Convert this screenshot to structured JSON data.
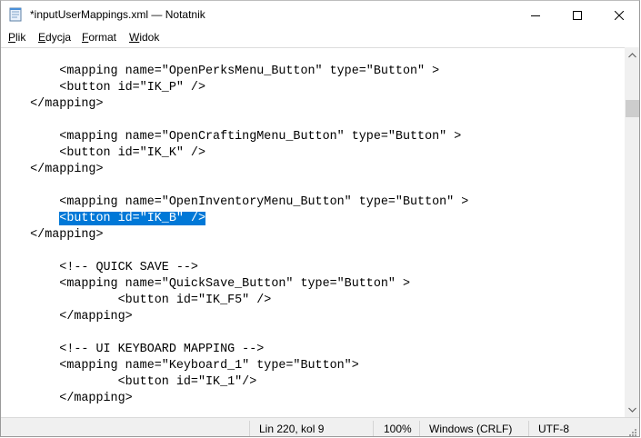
{
  "window": {
    "title": "*inputUserMappings.xml — Notatnik",
    "app_icon": "notepad-icon",
    "controls": {
      "minimize_icon": "minimize-icon",
      "maximize_icon": "maximize-icon",
      "close_icon": "close-icon"
    }
  },
  "menu": {
    "items": [
      {
        "accel": "P",
        "rest": "lik"
      },
      {
        "accel": "E",
        "rest": "dycja"
      },
      {
        "accel": "F",
        "rest": "ormat"
      },
      {
        "accel": "W",
        "rest": "idok"
      }
    ]
  },
  "editor": {
    "lines": [
      "",
      "        <mapping name=\"OpenPerksMenu_Button\" type=\"Button\" >",
      "        <button id=\"IK_P\" />",
      "    </mapping>",
      "",
      "        <mapping name=\"OpenCraftingMenu_Button\" type=\"Button\" >",
      "        <button id=\"IK_K\" />",
      "    </mapping>",
      "",
      "        <mapping name=\"OpenInventoryMenu_Button\" type=\"Button\" >",
      "        <button id=\"IK_B\" />",
      "    </mapping>",
      "",
      "        <!-- QUICK SAVE -->",
      "        <mapping name=\"QuickSave_Button\" type=\"Button\" >",
      "                <button id=\"IK_F5\" />",
      "        </mapping>",
      "",
      "        <!-- UI KEYBOARD MAPPING -->",
      "        <mapping name=\"Keyboard_1\" type=\"Button\">",
      "                <button id=\"IK_1\"/>",
      "        </mapping>"
    ],
    "selected_line_index": 10,
    "selected_text": "<button id=\"IK_B\" />",
    "selection_color": "#0078d7"
  },
  "statusbar": {
    "position": "Lin 220, kol 9",
    "zoom": "100%",
    "line_endings": "Windows (CRLF)",
    "encoding": "UTF-8"
  }
}
